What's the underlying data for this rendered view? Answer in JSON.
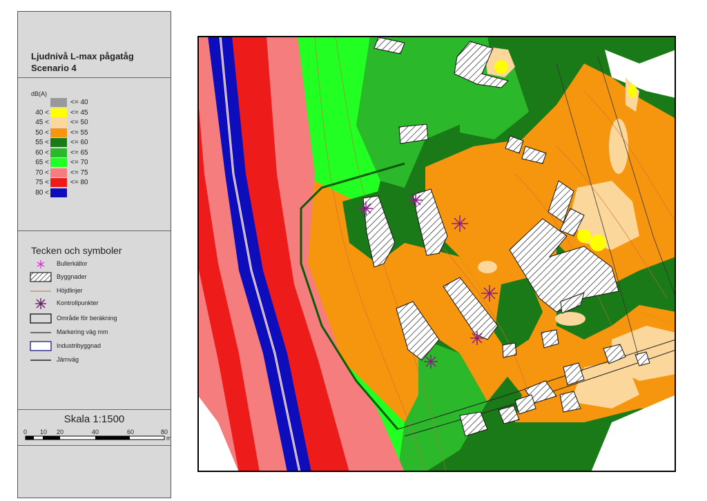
{
  "legend": {
    "title_line1": "Ljudnivå L-max pågatåg",
    "title_line2": "Scenario 4",
    "unit": "dB(A)",
    "classes": [
      {
        "lo": "",
        "hi": "<= 40",
        "color": "#999999"
      },
      {
        "lo": "40 <",
        "hi": "<= 45",
        "color": "#ffff00"
      },
      {
        "lo": "45 <",
        "hi": "<= 50",
        "color": "#fcd79c"
      },
      {
        "lo": "50 <",
        "hi": "<= 55",
        "color": "#f6960e"
      },
      {
        "lo": "55 <",
        "hi": "<= 60",
        "color": "#1b7a18"
      },
      {
        "lo": "60 <",
        "hi": "<= 65",
        "color": "#2bb82b"
      },
      {
        "lo": "65 <",
        "hi": "<= 70",
        "color": "#22ff22"
      },
      {
        "lo": "70 <",
        "hi": "<= 75",
        "color": "#f57d7d"
      },
      {
        "lo": "75 <",
        "hi": "<= 80",
        "color": "#ee1b1b"
      },
      {
        "lo": "80 <",
        "hi": "",
        "color": "#0d0dbb"
      }
    ],
    "symbols_title": "Tecken och symboler",
    "symbols": [
      {
        "label": "Bullerkällor",
        "icon": "magenta-asterisk-icon"
      },
      {
        "label": "Byggnader",
        "icon": "hatched-box-icon"
      },
      {
        "label": "Höjdlinjer",
        "icon": "orange-line-icon"
      },
      {
        "label": "Kontrollpunkter",
        "icon": "purple-asterisk-icon"
      },
      {
        "label": "Område för beräkning",
        "icon": "outlined-box-icon"
      },
      {
        "label": "Markering väg mm",
        "icon": "thin-line-icon"
      },
      {
        "label": "Industribyggnad",
        "icon": "blue-outlined-box-icon"
      },
      {
        "label": "Järnväg",
        "icon": "black-line-icon"
      }
    ],
    "scale_title": "Skala 1:1500",
    "scale_ticks": [
      "0",
      "10",
      "20",
      "40",
      "60",
      "80"
    ],
    "scale_unit": "m"
  }
}
